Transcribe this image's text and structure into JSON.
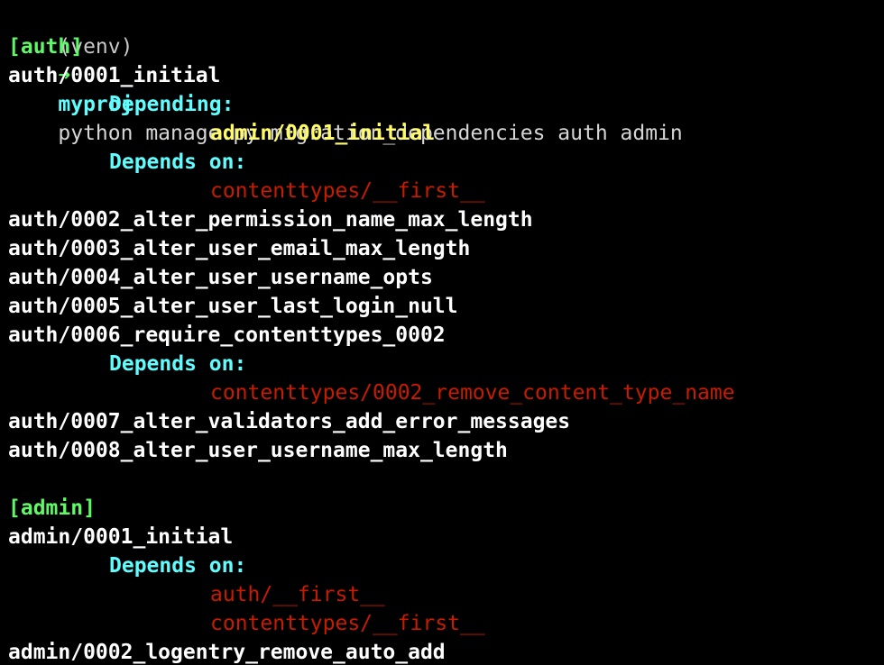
{
  "terminal": {
    "prompt": {
      "venv": "(venv)",
      "arrow": "➜",
      "cwd": "myproj",
      "command": "python manage.py migration_dependencies auth admin"
    },
    "auth": {
      "header": "[auth]",
      "m0001": "auth/0001_initial",
      "m0001_depending_label": "Depending:",
      "m0001_depending_item": "admin/0001_initial",
      "m0001_depends_label": "Depends on:",
      "m0001_depends_item": "contenttypes/__first__",
      "m0002": "auth/0002_alter_permission_name_max_length",
      "m0003": "auth/0003_alter_user_email_max_length",
      "m0004": "auth/0004_alter_user_username_opts",
      "m0005": "auth/0005_alter_user_last_login_null",
      "m0006": "auth/0006_require_contenttypes_0002",
      "m0006_depends_label": "Depends on:",
      "m0006_depends_item": "contenttypes/0002_remove_content_type_name",
      "m0007": "auth/0007_alter_validators_add_error_messages",
      "m0008": "auth/0008_alter_user_username_max_length"
    },
    "admin": {
      "header": "[admin]",
      "m0001": "admin/0001_initial",
      "m0001_depends_label": "Depends on:",
      "m0001_depends_item_1": "auth/__first__",
      "m0001_depends_item_2": "contenttypes/__first__",
      "m0002": "admin/0002_logentry_remove_auto_add"
    }
  },
  "colors": {
    "background": "#000000",
    "green": "#5ff967",
    "cyan": "#60fdff",
    "yellow": "#fefb67",
    "red": "#c91b00",
    "white": "#ffffff"
  }
}
